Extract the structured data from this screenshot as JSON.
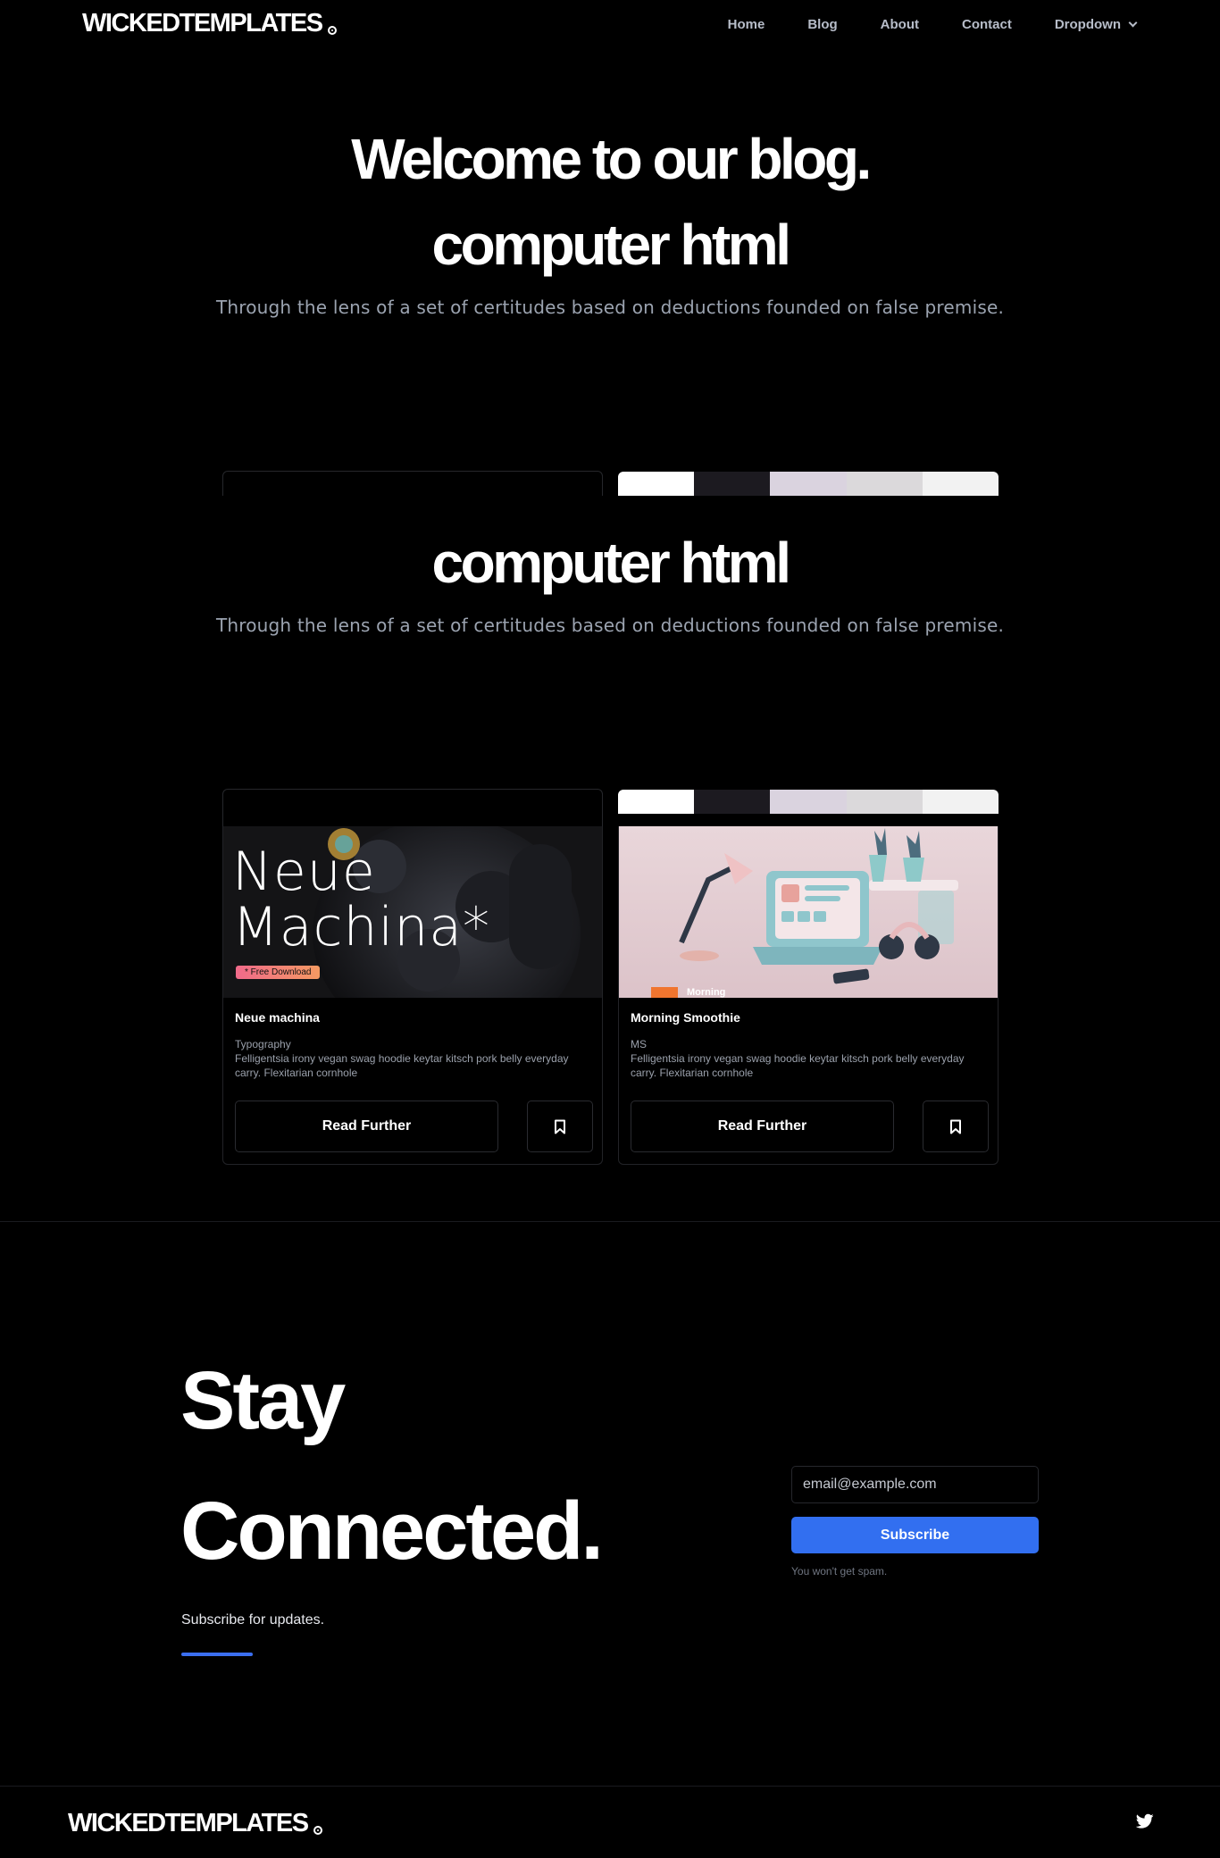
{
  "header": {
    "logo": "WICKEDTEMPLATES",
    "nav": [
      "Home",
      "Blog",
      "About",
      "Contact",
      "Dropdown"
    ]
  },
  "hero": {
    "title": "Welcome to our blog.",
    "subtitle_line": "computer html",
    "description": "Through the lens of a set of certitudes based on deductions founded on false premise."
  },
  "hero_repeat": {
    "subtitle_line": "computer html",
    "description": "Through the lens of a set of certitudes based on deductions founded on false premise."
  },
  "palette_colors": [
    "#ffffff",
    "#1c1a20",
    "#dad3df",
    "#dbd9db",
    "#f2f2f2"
  ],
  "cards": [
    {
      "image_text_1": "Neue",
      "image_text_2": "Machina*",
      "image_badge": "* Free Download",
      "title": "Neue machina",
      "category": "Typography",
      "description": "Felligentsia irony vegan swag hoodie keytar kitsch pork belly everyday carry. Flexitarian cornhole",
      "read_label": "Read Further",
      "save_icon": "bookmark-icon"
    },
    {
      "image_text_1": "Morning",
      "image_text_2": "",
      "image_badge": "",
      "title": "Morning Smoothie",
      "category": "MS",
      "description": "Felligentsia irony vegan swag hoodie keytar kitsch pork belly everyday carry. Flexitarian cornhole",
      "read_label": "Read Further",
      "save_icon": "bookmark-icon"
    }
  ],
  "newsletter": {
    "title_line1": "Stay",
    "title_line2": "Connected.",
    "subtitle": "Subscribe for updates.",
    "email_placeholder": "email@example.com",
    "button": "Subscribe",
    "note": "You won't get spam.",
    "accent": "#326ff0"
  },
  "footer": {
    "logo": "WICKEDTEMPLATES",
    "social_icon": "twitter-icon"
  }
}
